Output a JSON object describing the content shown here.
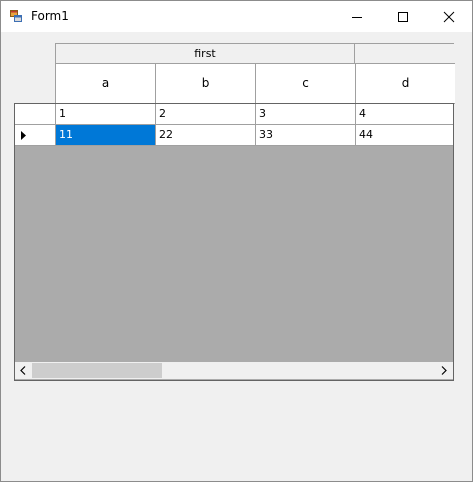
{
  "window": {
    "title": "Form1"
  },
  "grid": {
    "group_header": "first",
    "columns": [
      "a",
      "b",
      "c",
      "d"
    ],
    "rows": [
      [
        "1",
        "2",
        "3",
        "4"
      ],
      [
        "11",
        "22",
        "33",
        "44"
      ]
    ],
    "current_row": 1,
    "selected_cell": [
      1,
      0
    ]
  },
  "colors": {
    "selection": "#0078d7",
    "grid_background": "#ababab",
    "form_background": "#f0f0f0"
  },
  "icons": {
    "app": "winforms-app-icon",
    "minimize": "minimize-icon",
    "maximize": "maximize-icon",
    "close": "close-icon",
    "row_indicator": "current-row-arrow-icon",
    "scroll_left": "chevron-left-icon",
    "scroll_right": "chevron-right-icon"
  }
}
